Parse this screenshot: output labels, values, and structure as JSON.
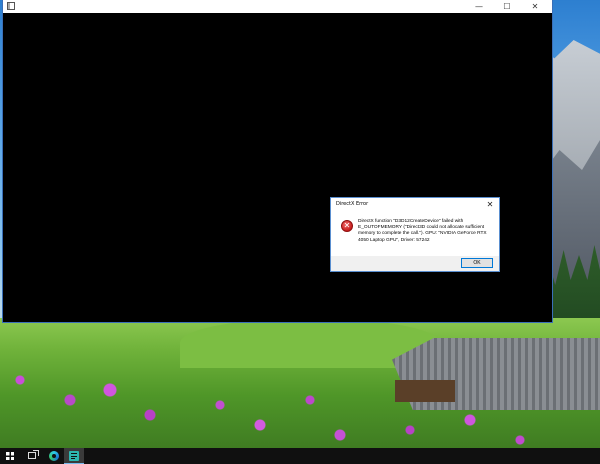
{
  "main_window": {
    "title": "",
    "minimize_glyph": "—",
    "maximize_glyph": "☐",
    "close_glyph": "✕"
  },
  "dialog": {
    "title": "DirectX Error",
    "close_glyph": "✕",
    "icon": "error-icon",
    "icon_glyph": "✕",
    "message": "DirectX function \"D3D12CreateDevice\" failed with E_OUTOFMEMORY (\"Direct3D could not allocate sufficient memory to complete the call.\"). GPU: \"NVIDIA GeForce RTX 4050 Laptop GPU\", Driver: 57242",
    "ok_label": "OK"
  },
  "taskbar": {
    "items": [
      {
        "name": "start",
        "icon": "windows-logo-icon"
      },
      {
        "name": "task-view",
        "icon": "task-view-icon"
      },
      {
        "name": "edge",
        "icon": "edge-browser-icon"
      },
      {
        "name": "running-app",
        "icon": "app-icon"
      }
    ]
  },
  "colors": {
    "accent": "#0078d7",
    "error": "#c81e1e",
    "taskbar": "#101010"
  }
}
